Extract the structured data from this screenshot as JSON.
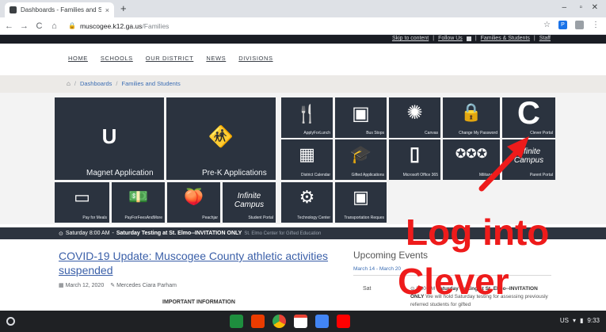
{
  "browser": {
    "tab_title": "Dashboards - Families and Stud",
    "tab_close": "×",
    "new_tab": "+",
    "window_controls": [
      "–",
      "▫",
      "✕"
    ],
    "nav_buttons": [
      "←",
      "→",
      "C",
      "⌂"
    ],
    "url_host": "muscogee.k12.ga.us",
    "url_path": "/Families",
    "bookmark_icon": "☆",
    "extension_label": "P",
    "menu_icon": "⋮"
  },
  "site": {
    "toplinks": [
      "Skip to content",
      "Follow Us",
      "Families & Students",
      "Staff"
    ],
    "toplink_sep": "|",
    "nav": [
      "HOME",
      "SCHOOLS",
      "OUR DISTRICT",
      "NEWS",
      "DIVISIONS"
    ],
    "breadcrumb": [
      "Dashboards",
      "Families and Students"
    ],
    "breadcrumb_sep": "/"
  },
  "tiles": {
    "magnet": "Magnet Application",
    "prek": "Pre-K Applications",
    "apply_lunch": "ApplyForLunch",
    "bus_stops": "Bus Stops",
    "canvas": "Canvas",
    "change_password": "Change My Password",
    "clever": "Clever Portal",
    "district_calendar": "District Calendar",
    "gifted": "Gifted Applications",
    "office365": "Microsoft Office 365",
    "military": "Military Fa",
    "parent_portal": "Parent Portal",
    "pay_meals": "Pay for Meals",
    "pay_fees": "PayForFeesAndMore",
    "peachjar": "Peachjar",
    "student_portal": "Student Portal",
    "tech_center": "Technology Center",
    "transport": "Transportation Reques",
    "infinite_campus_logo": "Infinite Campus",
    "clever_logo_letter": "C"
  },
  "ticker": {
    "time": "Saturday 8:00 AM",
    "dash": "-",
    "headline": "Saturday Testing at St. Elmo--INVITATION ONLY",
    "tail": "St. Elmo Center for Gifted Education"
  },
  "article": {
    "title": "COVID-19 Update: Muscogee County athletic activities suspended",
    "date": "March 12, 2020",
    "author": "Mercedes Ciara Parham",
    "important": "IMPORTANT INFORMATION"
  },
  "events": {
    "title": "Upcoming Events",
    "range": "March 14 - March 20",
    "day": "Sat",
    "time": "8:00 AM",
    "headline": "Saturday Testing at St. Elmo--INVITATION ONLY",
    "body": "We will hold Saturday testing for assessing previously referred students for gifted"
  },
  "annotation": {
    "line1": "Log into",
    "line2": "Clever",
    "color": "#ee1b1b"
  },
  "shelf": {
    "status": "US",
    "time": "9:33"
  }
}
